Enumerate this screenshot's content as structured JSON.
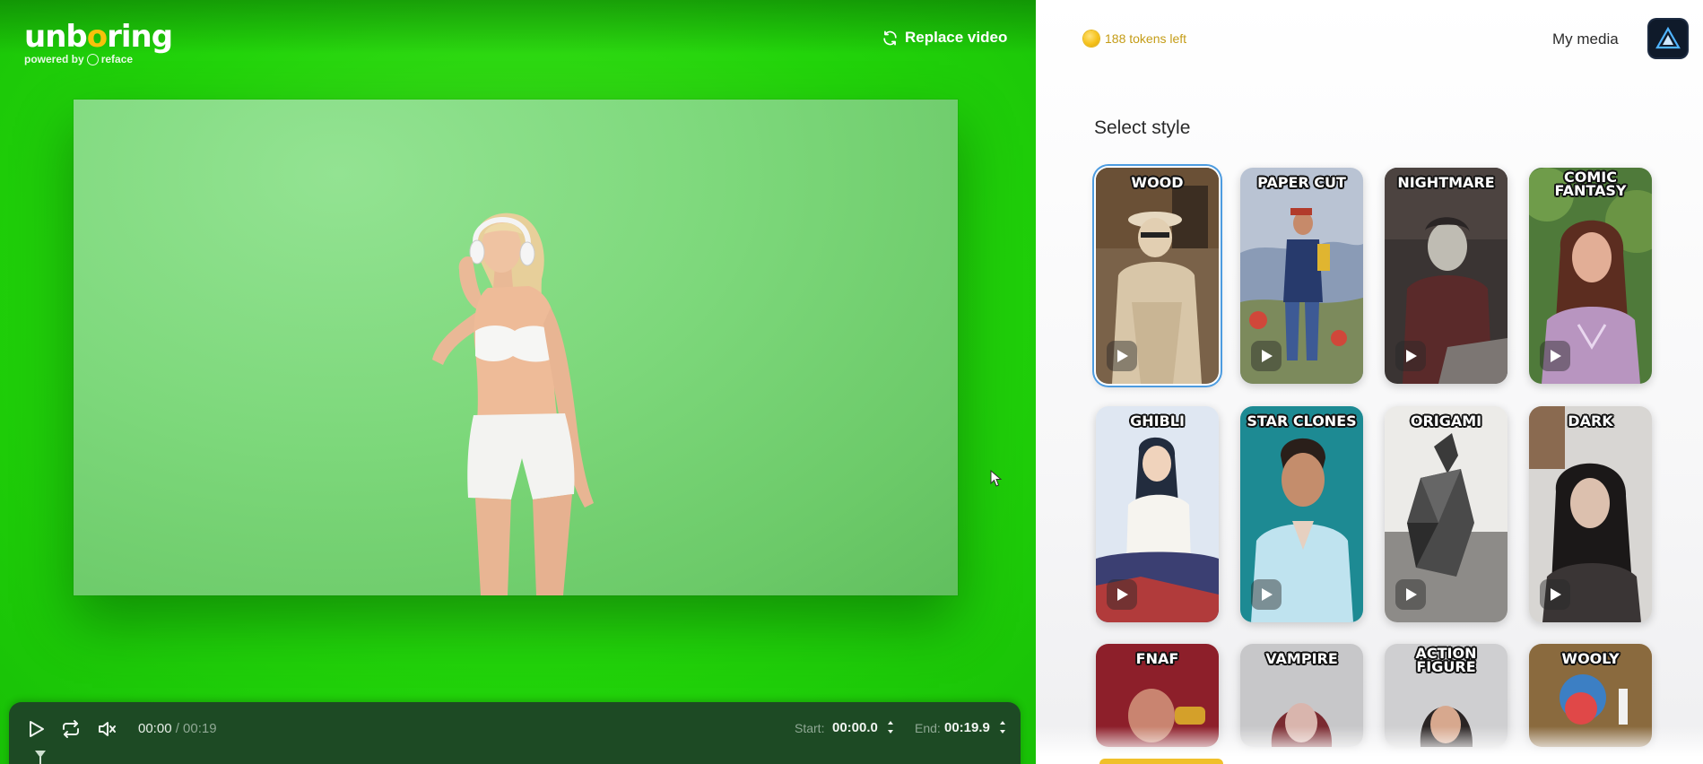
{
  "app": {
    "logo_text": "unboring",
    "logo_sub": "powered by reface",
    "replace_video_label": "Replace video"
  },
  "player": {
    "current_time": "00:00",
    "total_time": "/ 00:19",
    "start_label": "Start:",
    "start_value": "00:00.0",
    "end_label": "End:",
    "end_value": "00:19.9"
  },
  "header": {
    "tokens_label": "188 tokens left",
    "my_media_label": "My media"
  },
  "styles": {
    "title": "Select style",
    "selected": "WOOD",
    "items": [
      {
        "label": "WOOD"
      },
      {
        "label": "PAPER CUT"
      },
      {
        "label": "NIGHTMARE"
      },
      {
        "label": "COMIC FANTASY"
      },
      {
        "label": "GHIBLI"
      },
      {
        "label": "STAR CLONES"
      },
      {
        "label": "ORIGAMI"
      },
      {
        "label": "DARK"
      },
      {
        "label": "FNAF"
      },
      {
        "label": "VAMPIRE"
      },
      {
        "label": "ACTION FIGURE"
      },
      {
        "label": "WOOLY"
      }
    ]
  },
  "colors": {
    "chroma_green": "#22d40a",
    "player_bar": "#1d4a24",
    "token_gold": "#c49c16",
    "selected_ring": "#4d9ce0"
  },
  "icons": {
    "replace": "refresh-icon",
    "play": "play-icon",
    "loop": "loop-icon",
    "mute": "volume-muted-icon",
    "coin": "coin-icon",
    "avatar": "triangle-logo-icon"
  }
}
